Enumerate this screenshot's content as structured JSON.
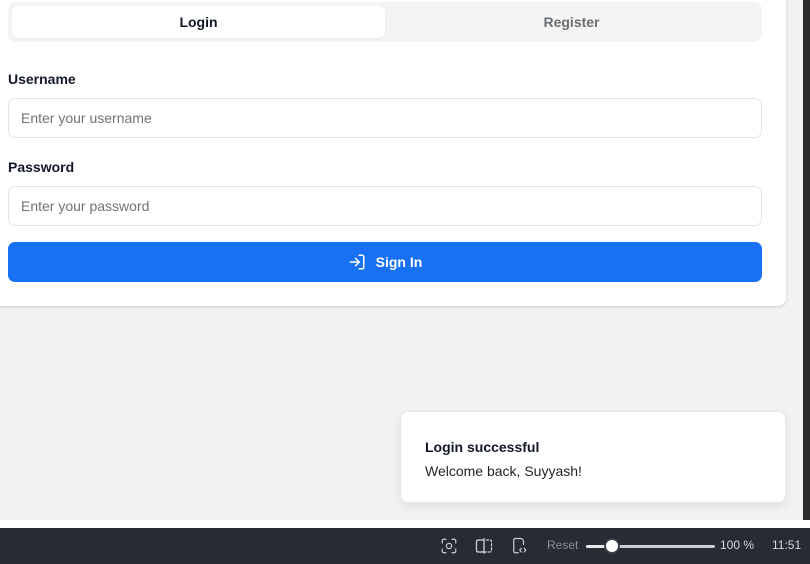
{
  "auth_tabs": {
    "login_label": "Login",
    "register_label": "Register"
  },
  "form": {
    "username_label": "Username",
    "username_placeholder": "Enter your username",
    "username_value": "",
    "password_label": "Password",
    "password_placeholder": "Enter your password",
    "password_value": "",
    "submit_label": "Sign In",
    "submit_icon": "login-arrow-icon"
  },
  "toast": {
    "title": "Login successful",
    "description": "Welcome back, Suyyash!"
  },
  "taskbar": {
    "icons": [
      "screenshot-icon",
      "split-view-icon",
      "device-code-icon"
    ],
    "reset_label": "Reset",
    "zoom_level": "100 %",
    "zoom_fraction": 0.2,
    "clock": "11:51"
  },
  "colors": {
    "primary": "#1870f5",
    "page_background": "#f1f2f4",
    "taskbar": "#272b33"
  }
}
